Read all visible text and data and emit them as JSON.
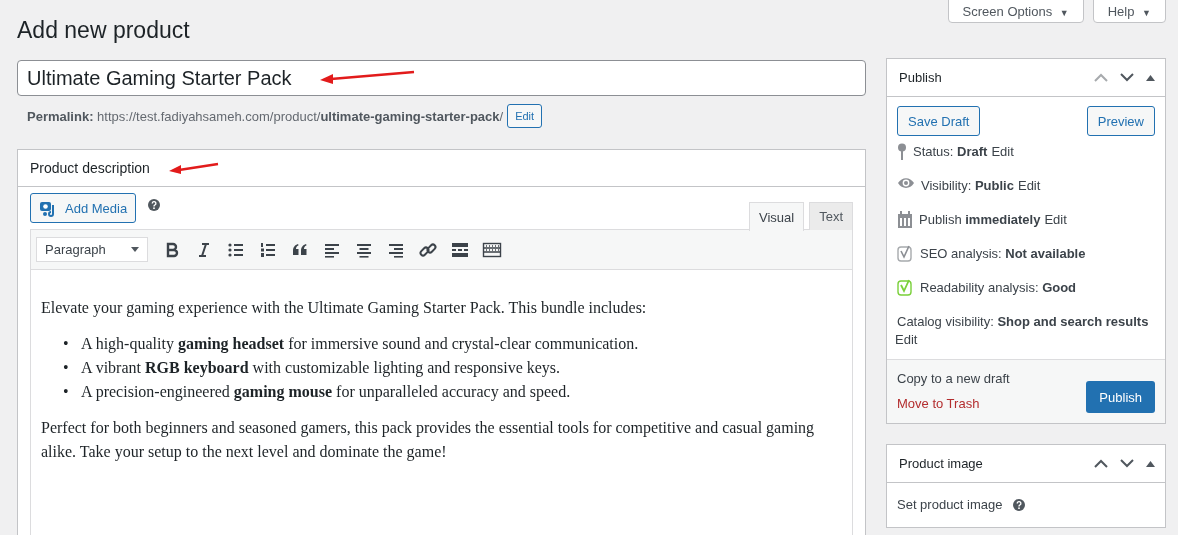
{
  "header_buttons": [
    {
      "label": "Screen Options",
      "caret": "▼"
    },
    {
      "label": "Help",
      "caret": "▼"
    }
  ],
  "page_title": "Add new product",
  "title_field": {
    "value": "Ultimate Gaming Starter Pack"
  },
  "permalink": {
    "label": "Permalink:",
    "base": "https://test.fadiyahsameh.com/product/",
    "slug": "ultimate-gaming-starter-pack",
    "trail": "/",
    "button": "Edit"
  },
  "description": {
    "heading": "Product description",
    "add_media": "Add Media",
    "format_select": "Paragraph",
    "tabs": [
      {
        "label": "Visual",
        "selected": true
      },
      {
        "label": "Text",
        "selected": false
      }
    ],
    "content": [
      {
        "kind": "paragraph",
        "text": "Elevate your gaming experience with the Ultimate Gaming Starter Pack. This bundle includes:"
      },
      {
        "kind": "list",
        "items": [
          {
            "marker": "•",
            "text": "A high-quality **gaming headset** for immersive sound and crystal-clear communication."
          },
          {
            "marker": "•",
            "text": "A vibrant **RGB keyboard** with customizable lighting and responsive keys."
          },
          {
            "marker": "•",
            "text": "A precision-engineered **gaming mouse** for unparalleled accuracy and speed."
          }
        ]
      },
      {
        "kind": "paragraph",
        "text": "Perfect for both beginners and seasoned gamers, this pack provides the essential tools for competitive and casual gaming alike. Take your setup to the next level and dominate the game!"
      }
    ]
  },
  "publish": {
    "title": "Publish",
    "save_draft": "Save Draft",
    "preview": "Preview",
    "rows": [
      {
        "kind": "status",
        "text": "Status: **Draft**",
        "link": "Edit"
      },
      {
        "kind": "visibility",
        "text": "Visibility: **Public**",
        "link": "Edit"
      },
      {
        "kind": "schedule",
        "text": "Publish **immediately**",
        "link": "Edit"
      },
      {
        "kind": "seo",
        "text": "SEO analysis: **Not available**"
      },
      {
        "kind": "readability",
        "text": "Readability analysis: **Good**"
      },
      {
        "kind": "catalog",
        "text": "Catalog visibility: **Shop and search results**",
        "link": "Edit"
      }
    ],
    "copy_link": "Copy to a new draft",
    "trash_link": "Move to Trash",
    "publish_button": "Publish"
  },
  "product_image": {
    "title": "Product image",
    "link": "Set product image"
  }
}
